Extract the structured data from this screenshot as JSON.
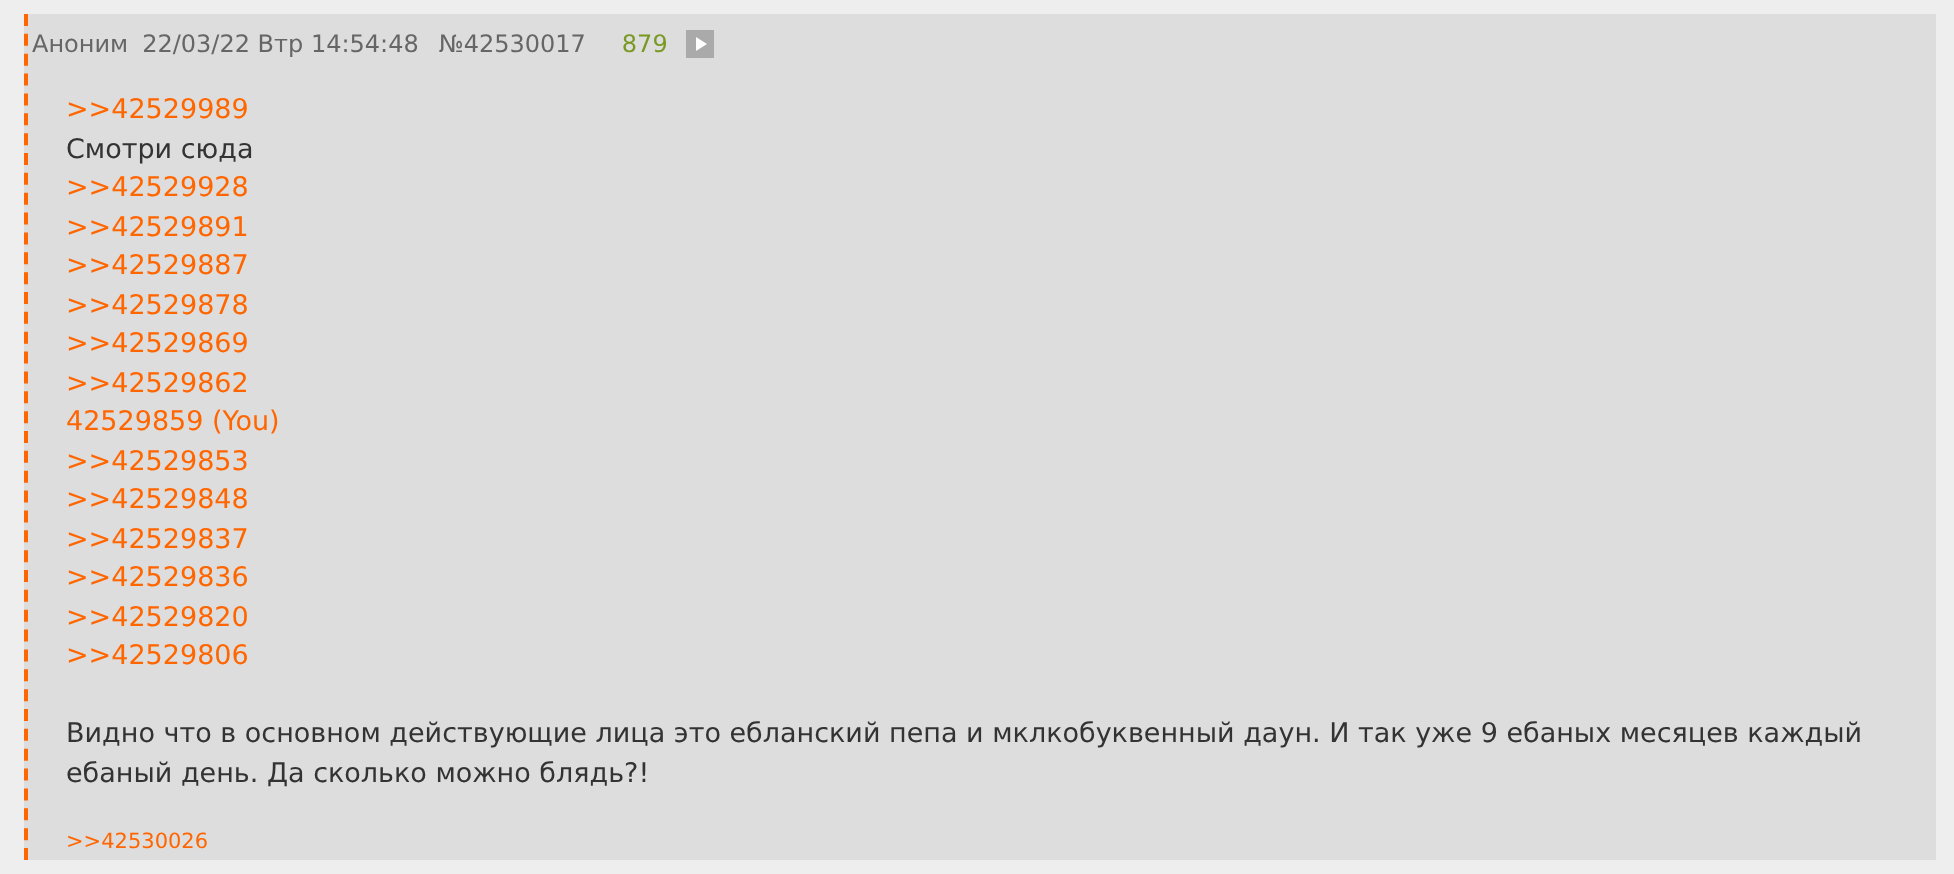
{
  "post": {
    "author": "Аноним",
    "date": "22/03/22 Втр 14:54:48",
    "number": "№42530017",
    "ordinal": "879",
    "lines": [
      {
        "kind": "reply-link",
        "text": ">>42529989"
      },
      {
        "kind": "text",
        "text": "Смотри сюда"
      },
      {
        "kind": "reply-link",
        "text": ">>42529928"
      },
      {
        "kind": "reply-link",
        "text": ">>42529891"
      },
      {
        "kind": "reply-link",
        "text": ">>42529887"
      },
      {
        "kind": "reply-link",
        "text": ">>42529878"
      },
      {
        "kind": "reply-link",
        "text": ">>42529869"
      },
      {
        "kind": "reply-link",
        "text": ">>42529862"
      },
      {
        "kind": "own-post",
        "text": "42529859 (You)"
      },
      {
        "kind": "reply-link",
        "text": ">>42529853"
      },
      {
        "kind": "reply-link",
        "text": ">>42529848"
      },
      {
        "kind": "reply-link",
        "text": ">>42529837"
      },
      {
        "kind": "reply-link",
        "text": ">>42529836"
      },
      {
        "kind": "reply-link",
        "text": ">>42529820"
      },
      {
        "kind": "reply-link",
        "text": ">>42529806"
      },
      {
        "kind": "blank"
      },
      {
        "kind": "text",
        "text": "Видно что в основном действующие лица это ебланский пепа и мклкобуквенный даун. И так уже 9 ебаных месяцев каждый ебаный день. Да сколько можно блядь?!"
      }
    ],
    "replies": [
      ">>42530026"
    ]
  }
}
